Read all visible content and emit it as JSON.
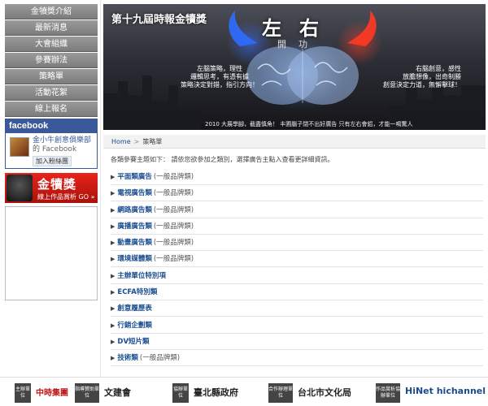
{
  "nav": {
    "items": [
      {
        "label": "金犢獎介紹"
      },
      {
        "label": "最新消息"
      },
      {
        "label": "大會組織"
      },
      {
        "label": "參賽辦法"
      },
      {
        "label": "策略單"
      },
      {
        "label": "活動花絮"
      },
      {
        "label": "線上報名"
      }
    ]
  },
  "facebook": {
    "title": "facebook",
    "page_name": "金小牛創意俱樂部",
    "platform": "的 Facebook",
    "like_label": "加入粉絲團"
  },
  "award": {
    "title": "金犢獎",
    "sub": "線上作品賞析 GO »"
  },
  "banner": {
    "title": "第十九屆時報金犢獎",
    "big_title": "左右",
    "small_title": "開功",
    "left_text": [
      "左腦策略，理性",
      "邏輯思考，有憑有據",
      "策略決定對錯，指引方向！"
    ],
    "right_text": [
      "右腦創意，感性",
      "放膽想像，出奇制勝",
      "創意決定力道，無懈擊球！"
    ],
    "caption": "2010 大展學腳，截盡慎角！ 丰圃腦子閉不出好廣告 只有左右會鋁，才能一鳴驚人"
  },
  "breadcrumb": {
    "home": "Home",
    "separator": ">",
    "current": "策略單"
  },
  "intro": "各類參賽主題如下： 請依您欲參加之類別，選擇廣告主點入查看更詳細資訊。",
  "categories": [
    {
      "name": "平面類廣告",
      "note": "(一般品牌類)"
    },
    {
      "name": "電視廣告類",
      "note": "(一般品牌類)"
    },
    {
      "name": "網路廣告類",
      "note": "(一般品牌類)"
    },
    {
      "name": "廣播廣告類",
      "note": "(一般品牌類)"
    },
    {
      "name": "動畫廣告類",
      "note": "(一般品牌類)"
    },
    {
      "name": "環境媒體類",
      "note": "(一般品牌類)"
    },
    {
      "name": "主辦單位特別項",
      "note": ""
    },
    {
      "name": "ECFA特別類",
      "note": ""
    },
    {
      "name": "創意履歷表",
      "note": ""
    },
    {
      "name": "行銷企劃類",
      "note": ""
    },
    {
      "name": "DV短片類",
      "note": ""
    },
    {
      "name": "技術類",
      "note": "(一般品牌類)"
    }
  ],
  "footer": {
    "labels": [
      "主辦單位",
      "指導贊助單位",
      "協辦單位",
      "合作辦理單位",
      "作品賞析協辦單位"
    ],
    "logos": [
      "中時集團",
      "文建會",
      "臺北縣政府",
      "台北市文化局",
      "HiNet hichannel"
    ]
  },
  "colors": {
    "nav_bg": "#8a8a8a",
    "facebook_blue": "#3b5998",
    "award_red": "#d01d14",
    "link_blue": "#1a4d8f"
  }
}
